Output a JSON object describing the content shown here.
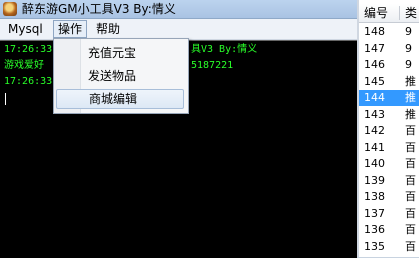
{
  "window": {
    "title": "醉东游GM小工具V3 By:情义"
  },
  "menubar": {
    "items": [
      "Mysql",
      "操作",
      "帮助"
    ]
  },
  "dropdown": {
    "items": [
      "充值元宝",
      "发送物品",
      "商城编辑"
    ],
    "highlighted": "商城编辑"
  },
  "console": {
    "lines": [
      "17:26:33",
      "具V3 By:情义",
      "游戏爱好",
      "5187221",
      "17:26:33"
    ]
  },
  "list": {
    "columns": [
      "编号",
      "类"
    ],
    "rows": [
      {
        "id": "148",
        "v": "9"
      },
      {
        "id": "147",
        "v": "9"
      },
      {
        "id": "146",
        "v": "9"
      },
      {
        "id": "145",
        "v": "推"
      },
      {
        "id": "144",
        "v": "推"
      },
      {
        "id": "143",
        "v": "推"
      },
      {
        "id": "142",
        "v": "百"
      },
      {
        "id": "141",
        "v": "百"
      },
      {
        "id": "140",
        "v": "百"
      },
      {
        "id": "139",
        "v": "百"
      },
      {
        "id": "138",
        "v": "百"
      },
      {
        "id": "137",
        "v": "百"
      },
      {
        "id": "136",
        "v": "百"
      },
      {
        "id": "135",
        "v": "百"
      }
    ],
    "selected_id": "144"
  }
}
